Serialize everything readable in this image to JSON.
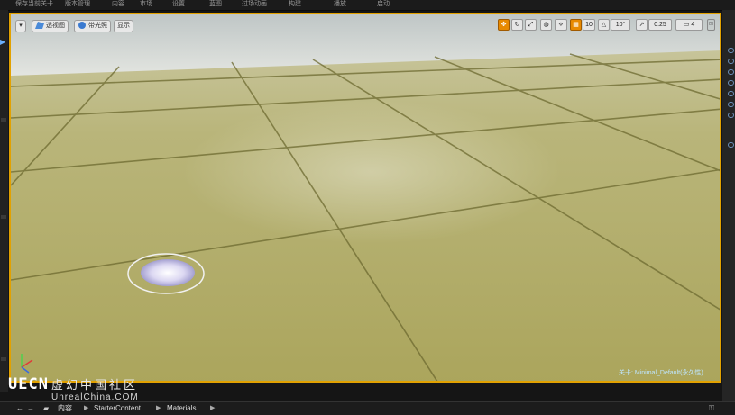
{
  "menu": {
    "items": [
      "保存当前关卡",
      "版本管理",
      "内容",
      "市场",
      "设置",
      "蓝图",
      "过场动画",
      "构建",
      "播放",
      "启动"
    ]
  },
  "viewport_toolbar": {
    "menu_icon": "chevron-down-icon",
    "perspective_label": "透视图",
    "lit_label": "带光照",
    "show_label": "显示",
    "grid_snap_value": "10",
    "rotation_snap_value": "10°",
    "scale_snap_value": "0.25",
    "camera_speed_value": "4"
  },
  "viewport": {
    "level_label": "关卡:  Minimal_Default(永久性)",
    "accent_color": "#e2a100"
  },
  "watermark": {
    "logo": "UECN",
    "cn": "虚幻中国社区",
    "url": "UnrealChina.COM"
  },
  "breadcrumb": {
    "items": [
      "内容",
      "StarterContent",
      "Materials"
    ]
  }
}
